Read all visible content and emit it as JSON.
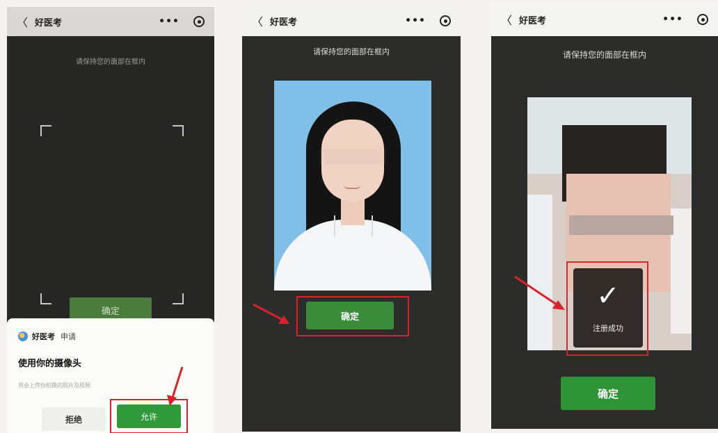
{
  "app_name": "好医考",
  "hint": "请保持您的面部在框内",
  "screens": [
    {
      "title": "好医考",
      "confirm_label": "确定",
      "permission": {
        "app": "好医考",
        "request": "申请",
        "title": "使用你的摄像头",
        "description": "将会上传你拍摄的照片及视频",
        "deny_label": "拒绝",
        "allow_label": "允许"
      }
    },
    {
      "title": "好医考",
      "confirm_label": "确定"
    },
    {
      "title": "好医考",
      "confirm_label": "确定",
      "toast": "注册成功"
    }
  ],
  "icons": [
    "back-chevron-icon",
    "more-dots-icon",
    "target-circle-icon",
    "checkmark-icon",
    "red-arrow-icon"
  ],
  "colors": {
    "accent_green": "#2f9a3a",
    "highlight_red": "#d8232a"
  }
}
